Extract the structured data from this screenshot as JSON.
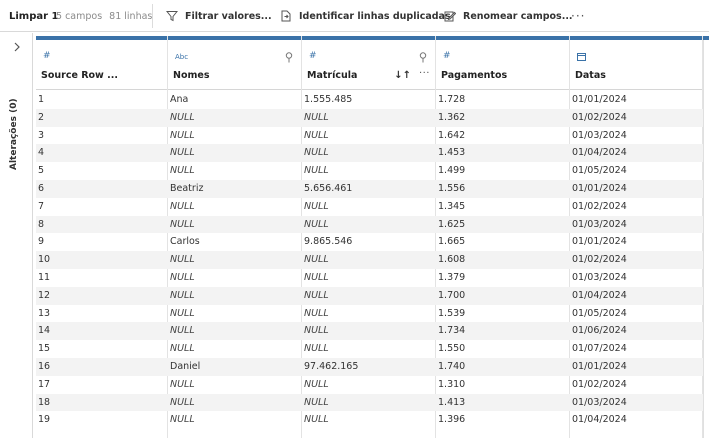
{
  "toolbar": {
    "title": "Limpar 1",
    "fields_count": "5 campos",
    "rows_count": "81 linhas",
    "filter_label": "Filtrar valores...",
    "dup_label": "Identificar linhas duplicadas",
    "rename_label": "Renomear campos...",
    "more_label": "···"
  },
  "sidebar": {
    "label": "Alterações (0)"
  },
  "columns": [
    {
      "type": "#",
      "name": "Source Row ..."
    },
    {
      "type": "Abc",
      "name": "Nomes"
    },
    {
      "type": "#",
      "name": "Matrícula",
      "sort": "↓↑",
      "more": "···"
    },
    {
      "type": "#",
      "name": "Pagamentos"
    },
    {
      "type": "calendar",
      "name": "Datas"
    }
  ],
  "rows": [
    [
      "1",
      "Ana",
      "1.555.485",
      "1.728",
      "01/01/2024"
    ],
    [
      "2",
      "NULL",
      "NULL",
      "1.362",
      "01/02/2024"
    ],
    [
      "3",
      "NULL",
      "NULL",
      "1.642",
      "01/03/2024"
    ],
    [
      "4",
      "NULL",
      "NULL",
      "1.453",
      "01/04/2024"
    ],
    [
      "5",
      "NULL",
      "NULL",
      "1.499",
      "01/05/2024"
    ],
    [
      "6",
      "Beatriz",
      "5.656.461",
      "1.556",
      "01/01/2024"
    ],
    [
      "7",
      "NULL",
      "NULL",
      "1.345",
      "01/02/2024"
    ],
    [
      "8",
      "NULL",
      "NULL",
      "1.625",
      "01/03/2024"
    ],
    [
      "9",
      "Carlos",
      "9.865.546",
      "1.665",
      "01/01/2024"
    ],
    [
      "10",
      "NULL",
      "NULL",
      "1.608",
      "01/02/2024"
    ],
    [
      "11",
      "NULL",
      "NULL",
      "1.379",
      "01/03/2024"
    ],
    [
      "12",
      "NULL",
      "NULL",
      "1.700",
      "01/04/2024"
    ],
    [
      "13",
      "NULL",
      "NULL",
      "1.539",
      "01/05/2024"
    ],
    [
      "14",
      "NULL",
      "NULL",
      "1.734",
      "01/06/2024"
    ],
    [
      "15",
      "NULL",
      "NULL",
      "1.550",
      "01/07/2024"
    ],
    [
      "16",
      "Daniel",
      "97.462.165",
      "1.740",
      "01/01/2024"
    ],
    [
      "17",
      "NULL",
      "NULL",
      "1.310",
      "01/02/2024"
    ],
    [
      "18",
      "NULL",
      "NULL",
      "1.413",
      "01/03/2024"
    ],
    [
      "19",
      "NULL",
      "NULL",
      "1.396",
      "01/04/2024"
    ]
  ],
  "colors": {
    "accent": "#3a72a8",
    "row_alt": "#f3f3f3"
  }
}
